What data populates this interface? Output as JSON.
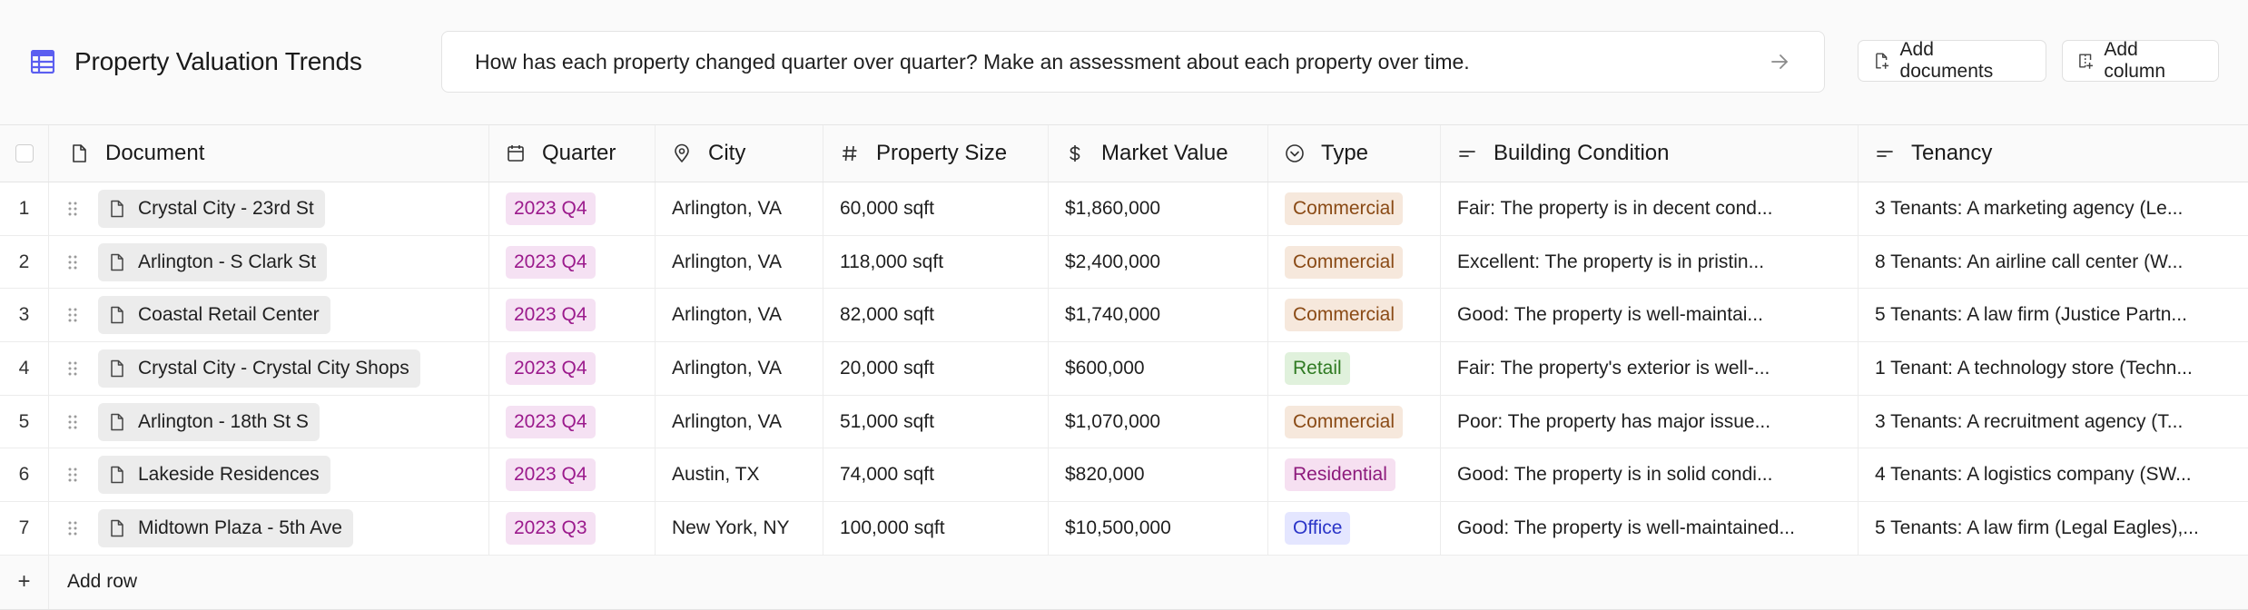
{
  "header": {
    "title": "Property Valuation Trends",
    "query": "How has each property changed quarter over quarter? Make an assessment about each property over time.",
    "add_documents": "Add documents",
    "add_column": "Add column"
  },
  "columns": {
    "document": "Document",
    "quarter": "Quarter",
    "city": "City",
    "size": "Property Size",
    "value": "Market Value",
    "type": "Type",
    "condition": "Building Condition",
    "tenancy": "Tenancy"
  },
  "rows": [
    {
      "idx": "1",
      "document": "Crystal City - 23rd St",
      "quarter": "2023 Q4",
      "city": "Arlington, VA",
      "size": "60,000 sqft",
      "value": "$1,860,000",
      "type": "Commercial",
      "condition": "Fair: The property is in decent cond...",
      "tenancy": "3 Tenants: A marketing agency (Le..."
    },
    {
      "idx": "2",
      "document": "Arlington - S Clark St",
      "quarter": "2023 Q4",
      "city": "Arlington, VA",
      "size": "118,000 sqft",
      "value": "$2,400,000",
      "type": "Commercial",
      "condition": "Excellent: The property is in pristin...",
      "tenancy": "8 Tenants: An airline call center (W..."
    },
    {
      "idx": "3",
      "document": "Coastal Retail Center",
      "quarter": "2023 Q4",
      "city": "Arlington, VA",
      "size": "82,000 sqft",
      "value": "$1,740,000",
      "type": "Commercial",
      "condition": "Good: The property is well-maintai...",
      "tenancy": "5 Tenants: A law firm (Justice Partn..."
    },
    {
      "idx": "4",
      "document": "Crystal City - Crystal City Shops",
      "quarter": "2023 Q4",
      "city": "Arlington, VA",
      "size": "20,000 sqft",
      "value": "$600,000",
      "type": "Retail",
      "condition": "Fair: The property's exterior is well-...",
      "tenancy": "1 Tenant: A technology store (Techn..."
    },
    {
      "idx": "5",
      "document": "Arlington - 18th St S",
      "quarter": "2023 Q4",
      "city": "Arlington, VA",
      "size": "51,000 sqft",
      "value": "$1,070,000",
      "type": "Commercial",
      "condition": "Poor: The property has major issue...",
      "tenancy": "3 Tenants: A recruitment agency (T..."
    },
    {
      "idx": "6",
      "document": "Lakeside Residences",
      "quarter": "2023 Q4",
      "city": "Austin, TX",
      "size": "74,000 sqft",
      "value": "$820,000",
      "type": "Residential",
      "condition": "Good: The property is in solid condi...",
      "tenancy": "4 Tenants: A logistics company (SW..."
    },
    {
      "idx": "7",
      "document": "Midtown Plaza - 5th Ave",
      "quarter": "2023 Q3",
      "city": "New York, NY",
      "size": "100,000 sqft",
      "value": "$10,500,000",
      "type": "Office",
      "condition": "Good: The property is well-maintained...",
      "tenancy": "5 Tenants: A law firm (Legal Eagles),..."
    }
  ],
  "footer": {
    "plus": "+",
    "add_row": "Add row"
  },
  "icons": {
    "app": "table-grid-icon",
    "submit": "arrow-right-icon",
    "add_documents": "file-plus-icon",
    "add_column": "column-plus-icon"
  },
  "colors": {
    "accent": "#5b5ef0",
    "quarter_badge": "#9b1a8c",
    "commercial_badge": "#8a4a15",
    "retail_badge": "#2f7a22",
    "residential_badge": "#8d1a7c",
    "office_badge": "#2b35c8"
  }
}
